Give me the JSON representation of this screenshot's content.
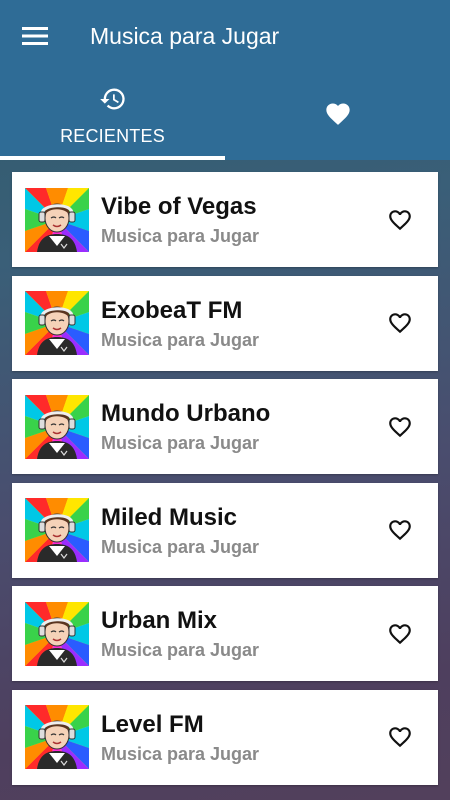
{
  "app": {
    "title": "Musica para Jugar",
    "bar_color": "#2f6c96"
  },
  "icons": {
    "menu": "menu-icon",
    "history": "history-icon",
    "favorites_tab": "heart-filled-icon",
    "favorite": "heart-outline-icon"
  },
  "tabs": [
    {
      "label": "RECIENTES",
      "icon": "history-icon",
      "selected": true
    },
    {
      "label": "",
      "icon": "heart-filled-icon",
      "selected": false
    }
  ],
  "stations": [
    {
      "name": "Vibe of Vegas",
      "subtitle": "Musica para Jugar"
    },
    {
      "name": "ExobeaT FM",
      "subtitle": "Musica para Jugar"
    },
    {
      "name": "Mundo Urbano",
      "subtitle": "Musica para Jugar"
    },
    {
      "name": "Miled Music",
      "subtitle": "Musica para Jugar"
    },
    {
      "name": "Urban Mix",
      "subtitle": "Musica para Jugar"
    },
    {
      "name": "Level FM",
      "subtitle": "Musica para Jugar"
    }
  ]
}
